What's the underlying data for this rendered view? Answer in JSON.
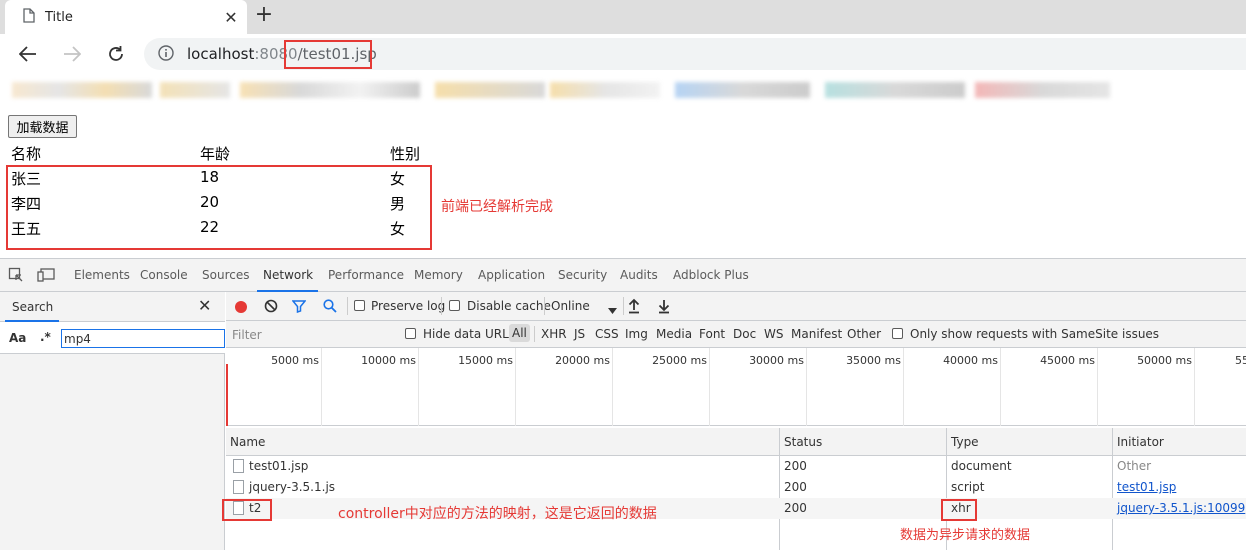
{
  "browser": {
    "tab_title": "Title",
    "tab_close": "✕",
    "new_tab": "+",
    "url_host": "localhost",
    "url_port": ":8080",
    "url_path": "/test01.jsp"
  },
  "page": {
    "load_button": "加载数据",
    "headers": [
      "名称",
      "年龄",
      "性别"
    ],
    "rows": [
      [
        "张三",
        "18",
        "女"
      ],
      [
        "李四",
        "20",
        "男"
      ],
      [
        "王五",
        "22",
        "女"
      ]
    ],
    "annotation_parsed": "前端已经解析完成"
  },
  "devtools": {
    "tabs": [
      "Elements",
      "Console",
      "Sources",
      "Network",
      "Performance",
      "Memory",
      "Application",
      "Security",
      "Audits",
      "Adblock Plus"
    ],
    "active_tab": "Network",
    "search": {
      "tab_label": "Search",
      "close": "✕",
      "case_label": "Aa",
      "regex_label": ".*",
      "query": "mp4"
    },
    "toolbar": {
      "preserve_log": "Preserve log",
      "disable_cache": "Disable cache",
      "throttle": "Online"
    },
    "filter": {
      "placeholder": "Filter",
      "hide_data_urls": "Hide data URLs",
      "types": [
        "All",
        "XHR",
        "JS",
        "CSS",
        "Img",
        "Media",
        "Font",
        "Doc",
        "WS",
        "Manifest",
        "Other"
      ],
      "samesite": "Only show requests with SameSite issues"
    },
    "timeline_ticks": [
      "5000 ms",
      "10000 ms",
      "15000 ms",
      "20000 ms",
      "25000 ms",
      "30000 ms",
      "35000 ms",
      "40000 ms",
      "45000 ms",
      "50000 ms",
      "55"
    ],
    "columns": [
      "Name",
      "Status",
      "Type",
      "Initiator"
    ],
    "requests": [
      {
        "name": "test01.jsp",
        "status": "200",
        "type": "document",
        "initiator": "Other"
      },
      {
        "name": "jquery-3.5.1.js",
        "status": "200",
        "type": "script",
        "initiator": "test01.jsp"
      },
      {
        "name": "t2",
        "status": "200",
        "type": "xhr",
        "initiator": "jquery-3.5.1.js:10099"
      }
    ],
    "annotation_controller": "controller中对应的方法的映射，这是它返回的数据",
    "annotation_xhr": "数据为异步请求的数据"
  },
  "colors": {
    "accent": "#1a73e8",
    "annotation": "#e53935",
    "record": "#e53935"
  }
}
